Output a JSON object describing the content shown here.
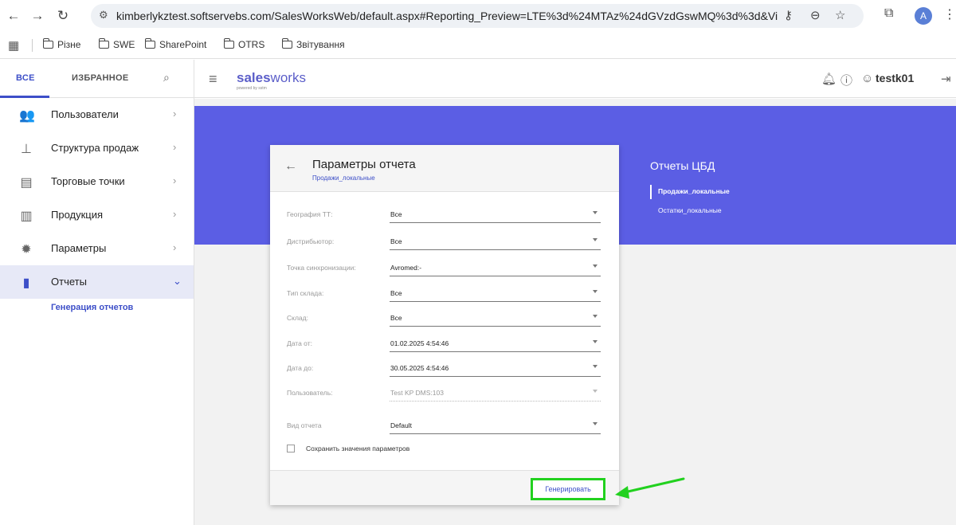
{
  "browser": {
    "url": "kimberlykztest.softservebs.com/SalesWorksWeb/default.aspx#Reporting_Preview=LTE%3d%24MTAz%24dGVzdGswMQ%3d%3d&ViewMode...",
    "profile_initial": "A",
    "bookmarks": [
      "Різне",
      "SWE",
      "SharePoint",
      "OTRS",
      "Звітування"
    ]
  },
  "header": {
    "logo_main_bold": "sales",
    "logo_main_rest": "works",
    "logo_sub": "powered by sstm",
    "username": "testk01"
  },
  "sidebar": {
    "tabs": [
      {
        "label": "ВСЕ"
      },
      {
        "label": "ИЗБРАННОЕ"
      }
    ],
    "items": [
      {
        "label": "Пользователи",
        "icon": "users-icon"
      },
      {
        "label": "Структура продаж",
        "icon": "hierarchy-icon"
      },
      {
        "label": "Торговые точки",
        "icon": "store-icon"
      },
      {
        "label": "Продукция",
        "icon": "products-icon"
      },
      {
        "label": "Параметры",
        "icon": "gear-icon"
      },
      {
        "label": "Отчеты",
        "icon": "report-icon"
      }
    ],
    "sub_item": "Генерация отчетов"
  },
  "reports_panel": {
    "title": "Отчеты ЦБД",
    "items": [
      "Продажи_локальные",
      "Остатки_локальные"
    ]
  },
  "card": {
    "title": "Параметры отчета",
    "subtitle": "Продажи_локальные",
    "params": [
      {
        "label": "География ТТ:",
        "value": "Все",
        "disabled": false
      },
      {
        "label": "Дистрибьютор:",
        "value": "Все",
        "disabled": false
      },
      {
        "label": "Точка синхронизации:",
        "value": "Avromed:-",
        "disabled": false
      },
      {
        "label": "Тип склада:",
        "value": "Все",
        "disabled": false
      },
      {
        "label": "Склад:",
        "value": "Все",
        "disabled": false
      },
      {
        "label": "Дата от:",
        "value": "01.02.2025 4:54:46",
        "disabled": false
      },
      {
        "label": "Дата до:",
        "value": "30.05.2025 4:54:46",
        "disabled": false
      },
      {
        "label": "Пользователь:",
        "value": "Test KP DMS:103",
        "disabled": true
      },
      {
        "label": "Вид отчета",
        "value": "Default",
        "disabled": false
      }
    ],
    "save_checkbox_label": "Сохранить значения параметров",
    "generate_label": "Генерировать"
  },
  "colors": {
    "accent": "#5b5ee4",
    "highlight": "#22d11f"
  }
}
